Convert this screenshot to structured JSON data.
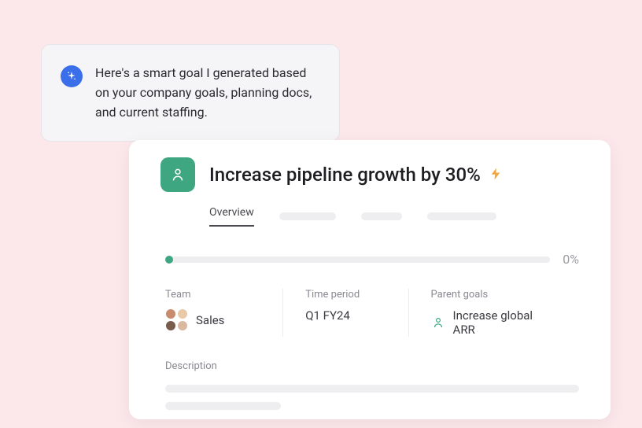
{
  "ai_popup": {
    "message": "Here's a smart goal I generated based on your company goals, planning docs, and current staffing."
  },
  "goal": {
    "title": "Increase pipeline growth by 30%",
    "tabs": {
      "overview": "Overview"
    },
    "progress": {
      "percent_label": "0%"
    },
    "meta": {
      "team": {
        "label": "Team",
        "value": "Sales"
      },
      "time_period": {
        "label": "Time period",
        "value": "Q1 FY24"
      },
      "parent_goals": {
        "label": "Parent goals",
        "value": "Increase global ARR"
      }
    },
    "description": {
      "label": "Description"
    }
  }
}
